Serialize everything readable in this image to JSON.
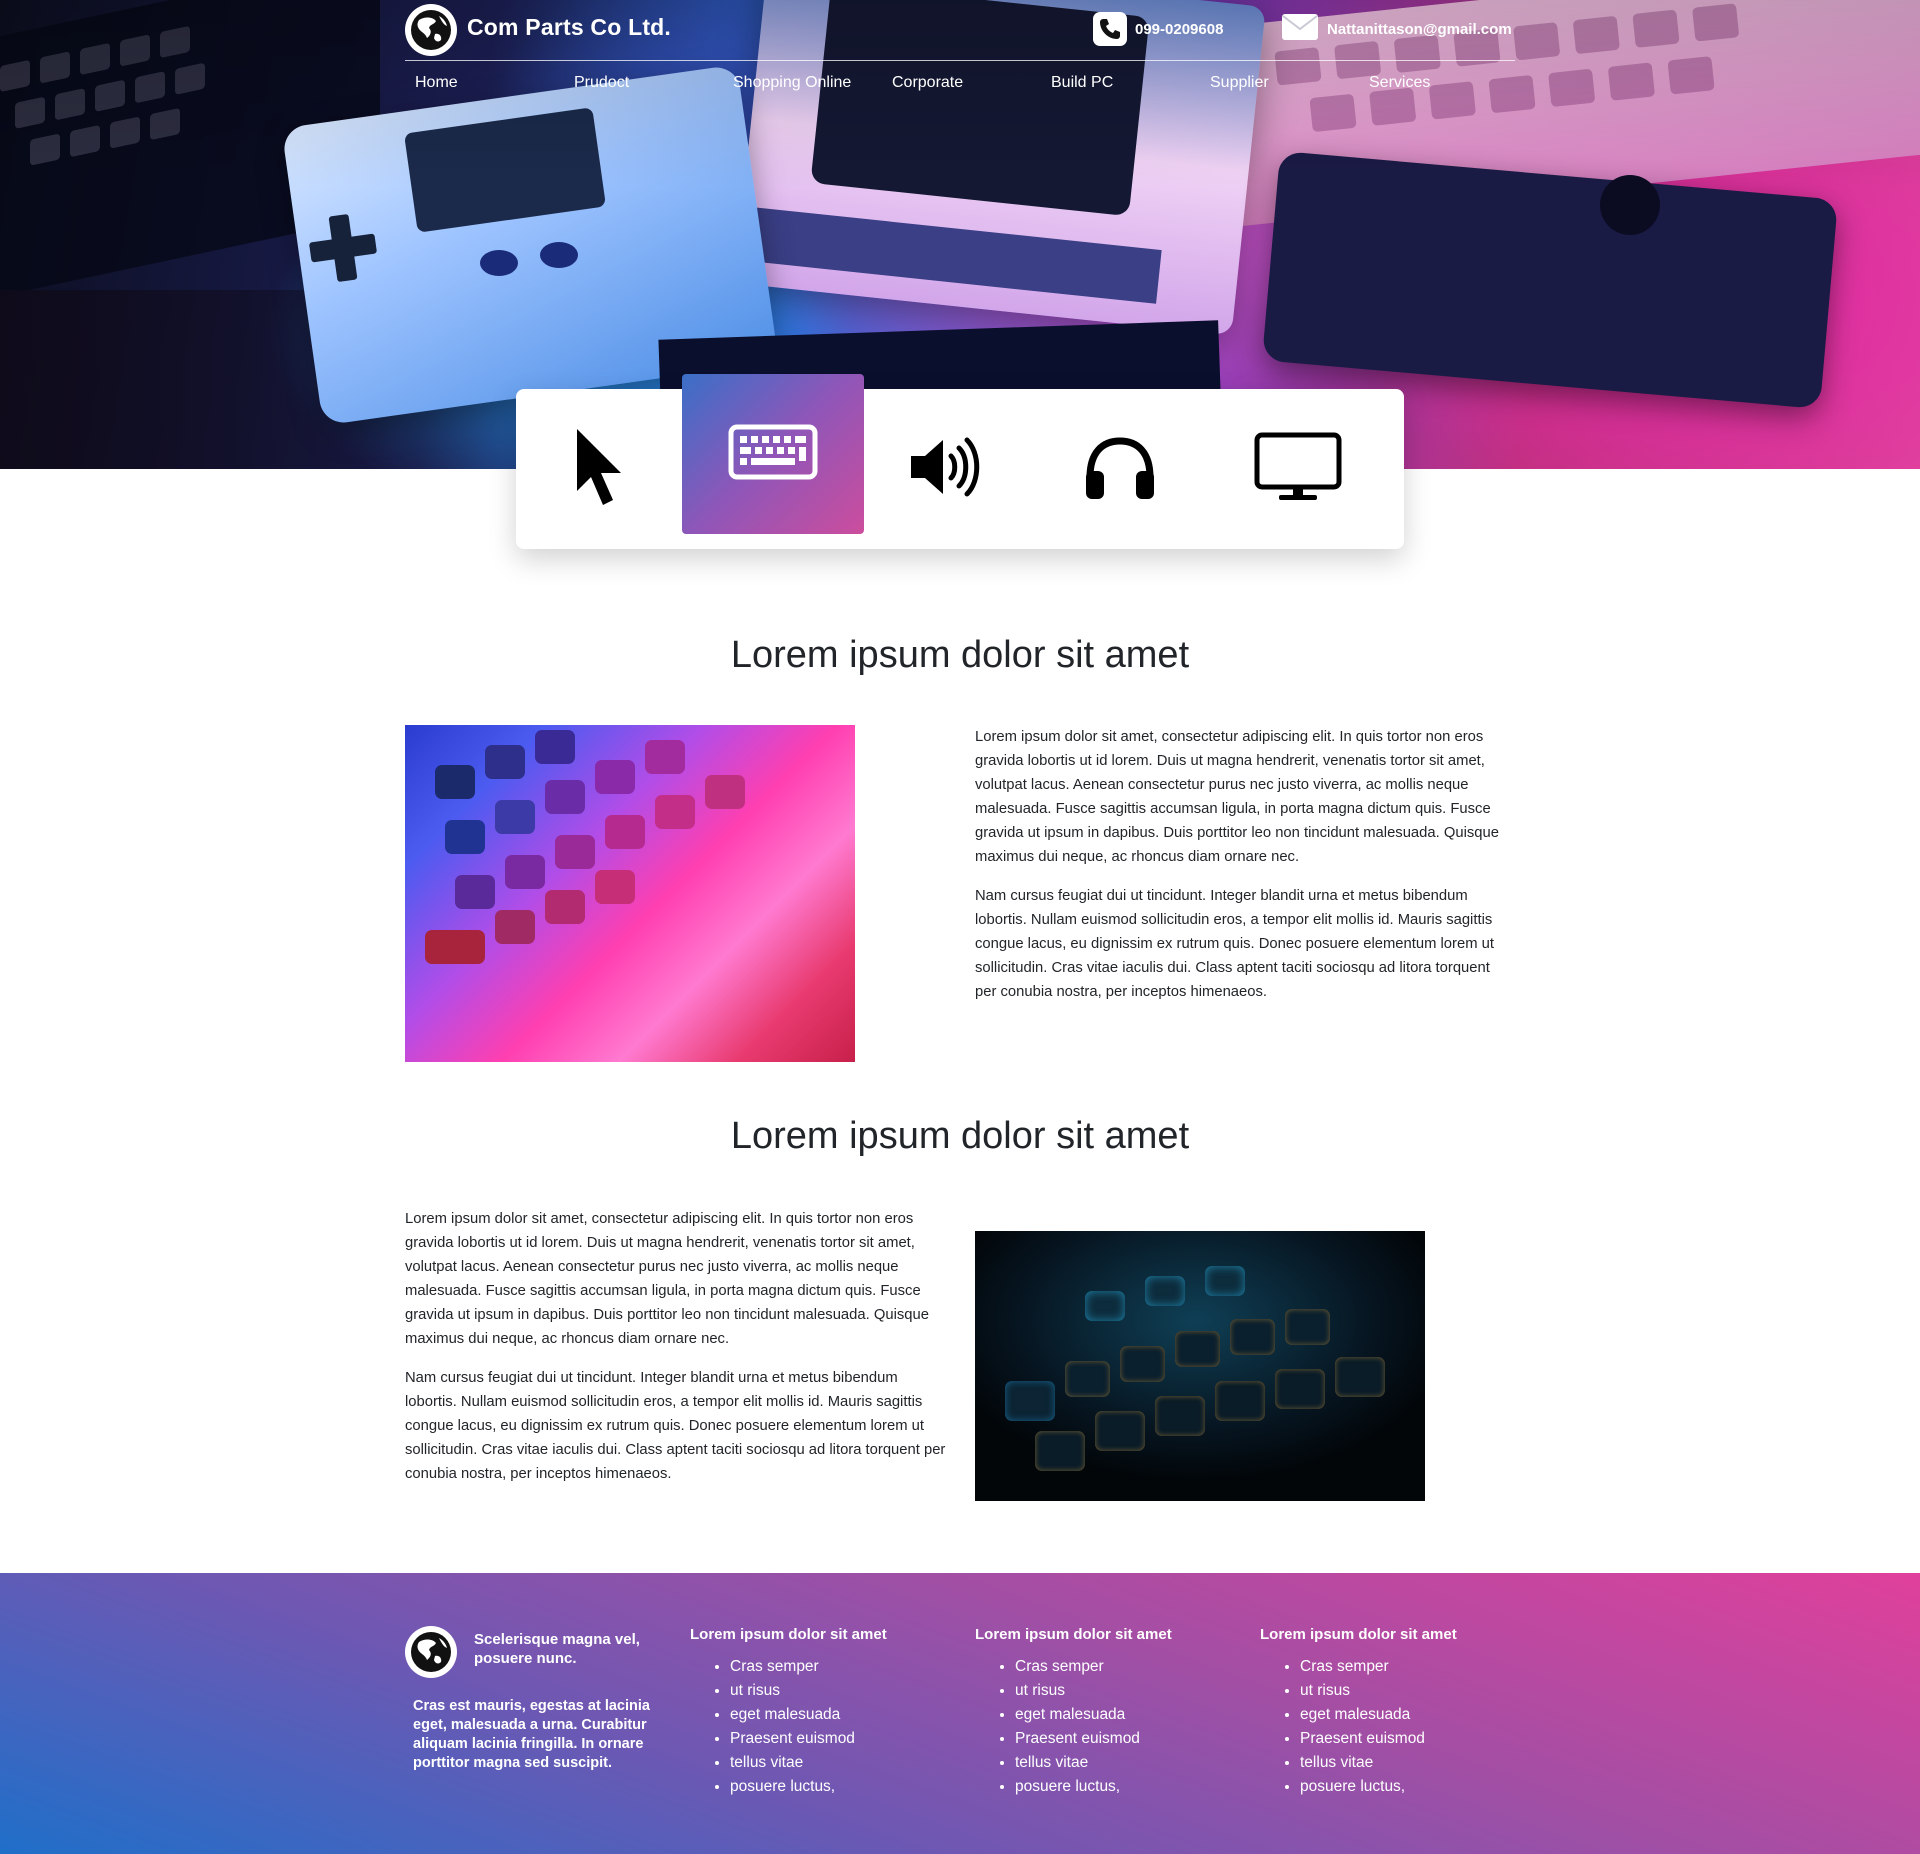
{
  "header": {
    "brand": "Com Parts Co Ltd.",
    "phone": "099-0209608",
    "email": "Nattanittason@gmail.com"
  },
  "nav": {
    "items": [
      {
        "label": "Home"
      },
      {
        "label": "Prudoct"
      },
      {
        "label": "Shopping Online"
      },
      {
        "label": "Corporate"
      },
      {
        "label": "Build PC"
      },
      {
        "label": "Supplier"
      },
      {
        "label": "Services"
      }
    ]
  },
  "categories": [
    {
      "icon": "mouse-pointer-icon",
      "active": false
    },
    {
      "icon": "keyboard-icon",
      "active": true
    },
    {
      "icon": "speaker-icon",
      "active": false
    },
    {
      "icon": "headphones-icon",
      "active": false
    },
    {
      "icon": "monitor-icon",
      "active": false
    }
  ],
  "sections": [
    {
      "title": "Lorem ipsum dolor sit amet",
      "paragraphs": [
        "Lorem ipsum dolor sit amet, consectetur adipiscing elit. In quis tortor non eros gravida lobortis ut id lorem. Duis ut magna hendrerit, venenatis tortor sit amet, volutpat lacus. Aenean consectetur purus nec justo viverra, ac mollis neque malesuada. Fusce sagittis accumsan ligula, in porta magna dictum quis. Fusce gravida ut ipsum in dapibus. Duis porttitor leo non tincidunt malesuada. Quisque maximus dui neque, ac rhoncus diam ornare nec.",
        "Nam cursus feugiat dui ut tincidunt. Integer blandit urna et metus bibendum lobortis. Nullam euismod sollicitudin eros, a tempor elit mollis id. Mauris sagittis congue lacus, eu dignissim ex rutrum quis. Donec posuere elementum lorem ut sollicitudin. Cras vitae iaculis dui. Class aptent taciti sociosqu ad litora torquent per conubia nostra, per inceptos himenaeos."
      ]
    },
    {
      "title": "Lorem ipsum dolor sit amet",
      "paragraphs": [
        "Lorem ipsum dolor sit amet, consectetur adipiscing elit. In quis tortor non eros gravida lobortis ut id lorem. Duis ut magna hendrerit, venenatis tortor sit amet, volutpat lacus. Aenean consectetur purus nec justo viverra, ac mollis neque malesuada. Fusce sagittis accumsan ligula, in porta magna dictum quis. Fusce gravida ut ipsum in dapibus. Duis porttitor leo non tincidunt malesuada. Quisque maximus dui neque, ac rhoncus diam ornare nec.",
        "Nam cursus feugiat dui ut tincidunt. Integer blandit urna et metus bibendum lobortis. Nullam euismod sollicitudin eros, a tempor elit mollis id. Mauris sagittis congue lacus, eu dignissim ex rutrum quis. Donec posuere elementum lorem ut sollicitudin. Cras vitae iaculis dui. Class aptent taciti sociosqu ad litora torquent per conubia nostra, per inceptos himenaeos."
      ]
    }
  ],
  "footer": {
    "tagline": "Scelerisque magna vel, posuere nunc.",
    "description": "Cras est mauris, egestas at lacinia eget, malesuada a urna. Curabitur aliquam lacinia fringilla. In ornare porttitor magna sed suscipit.",
    "columns": [
      {
        "title": "Lorem ipsum dolor sit amet",
        "items": [
          "Cras semper",
          "ut risus",
          "eget malesuada",
          "Praesent euismod",
          "tellus vitae",
          "posuere luctus,"
        ]
      },
      {
        "title": "Lorem ipsum dolor sit amet",
        "items": [
          "Cras semper",
          "ut risus",
          "eget malesuada",
          "Praesent euismod",
          "tellus vitae",
          "posuere luctus,"
        ]
      },
      {
        "title": "Lorem ipsum dolor sit amet",
        "items": [
          "Cras semper",
          "ut risus",
          "eget malesuada",
          "Praesent euismod",
          "tellus vitae",
          "posuere luctus,"
        ]
      }
    ]
  },
  "colors": {
    "gradient_blue": "#3a6fc7",
    "gradient_purple": "#8f56b8",
    "gradient_pink": "#cc4d9d",
    "text_dark": "#212529"
  }
}
